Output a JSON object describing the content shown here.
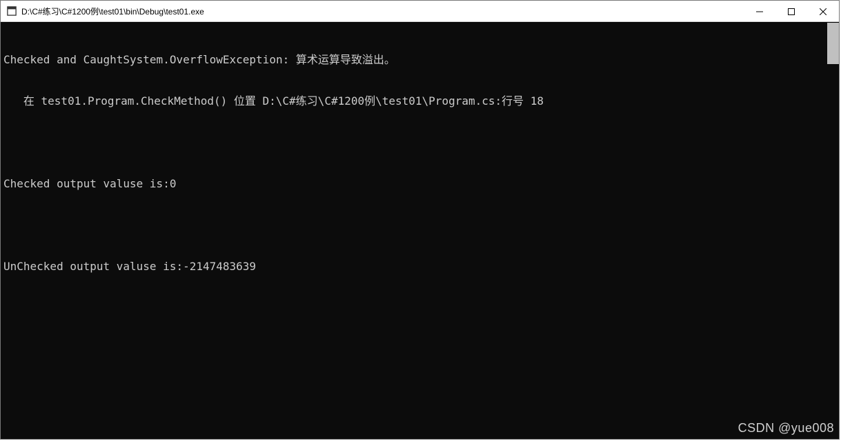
{
  "window": {
    "title": "D:\\C#练习\\C#1200例\\test01\\bin\\Debug\\test01.exe"
  },
  "console": {
    "line1": "Checked and CaughtSystem.OverflowException: 算术运算导致溢出。",
    "line2": "   在 test01.Program.CheckMethod() 位置 D:\\C#练习\\C#1200例\\test01\\Program.cs:行号 18",
    "line3": "",
    "line4": "Checked output valuse is:0",
    "line5": "",
    "line6": "UnChecked output valuse is:-2147483639"
  },
  "watermark": {
    "text": "CSDN @yue008"
  }
}
